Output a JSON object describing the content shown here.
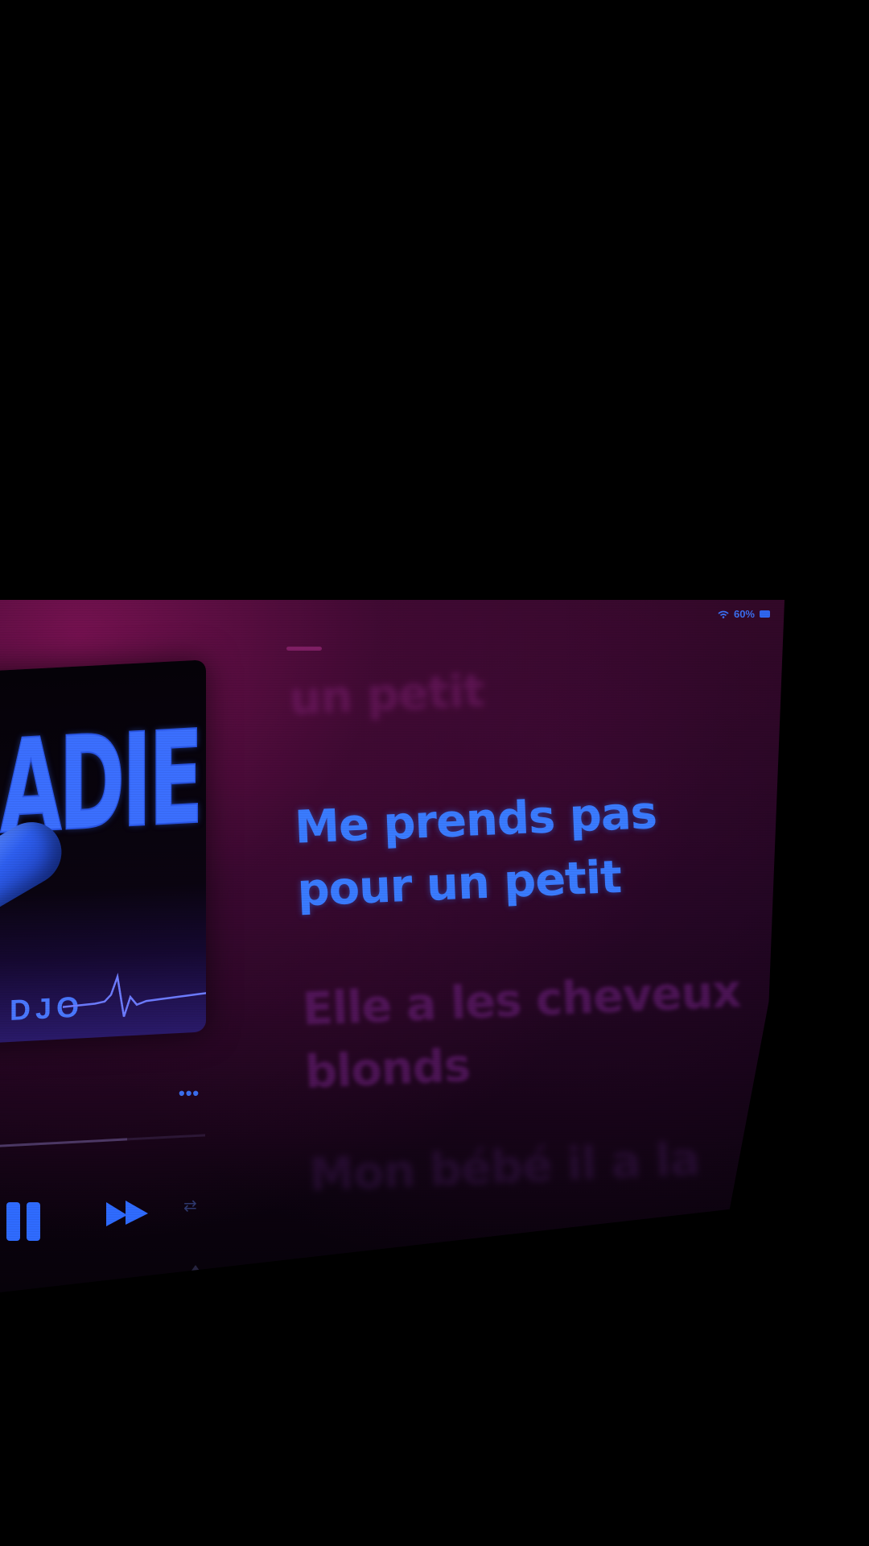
{
  "status_bar": {
    "battery": "60%",
    "icons": [
      "wifi-icon",
      "battery-icon"
    ]
  },
  "album": {
    "title_fragment": "ADIE",
    "artist_fragment": "DJO"
  },
  "player": {
    "more_label": "•••",
    "progress": 0.62,
    "icons": [
      "pause-icon",
      "fast-forward-icon",
      "repeat-icon",
      "airplay-icon",
      "lyrics-icon",
      "queue-icon"
    ]
  },
  "lyrics": {
    "past": "un petit",
    "current": "Me prends pas pour un petit",
    "next": "Elle a les cheveux blonds",
    "later": "Mon bébé il a la"
  },
  "colors": {
    "accent": "#3a7bff",
    "background_glow": "#781252",
    "dim_lyric": "#691e78"
  }
}
